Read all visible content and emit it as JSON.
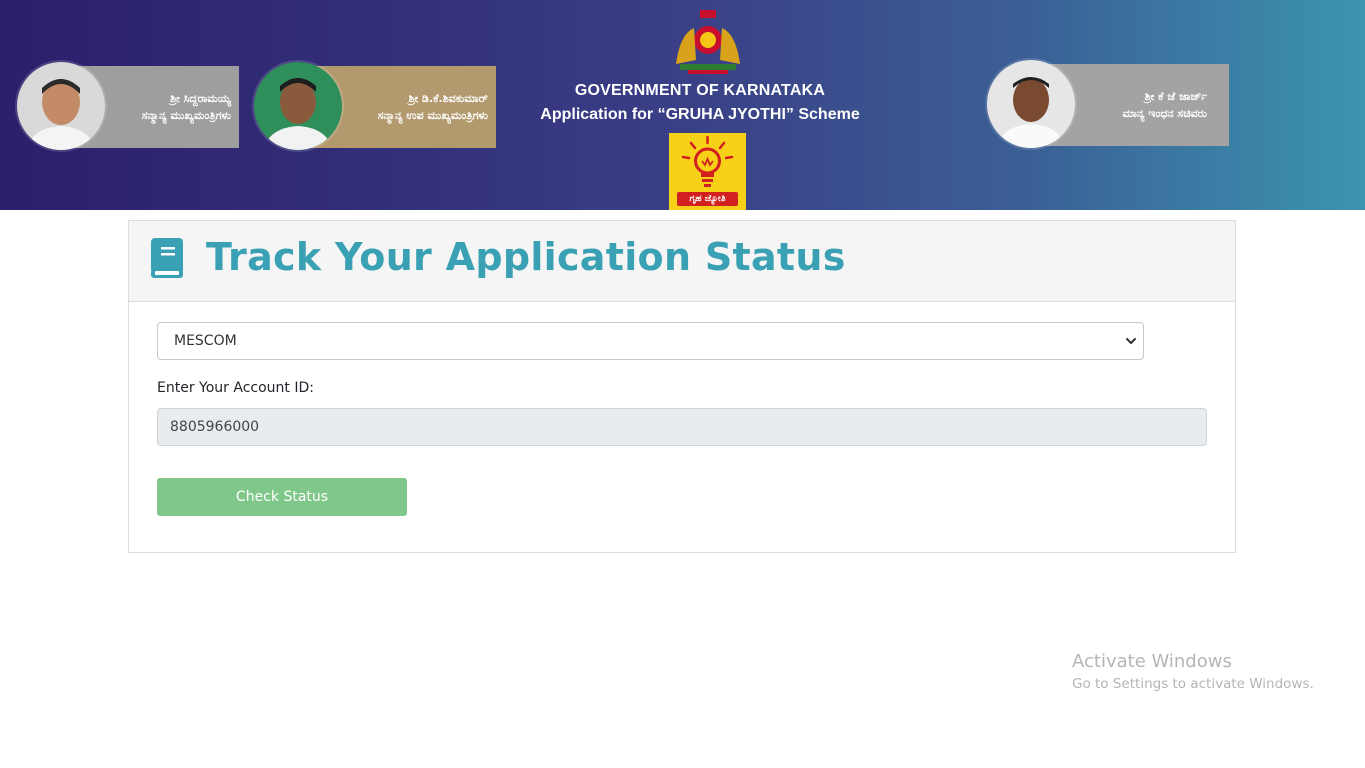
{
  "banner": {
    "leaders": [
      {
        "name_kn": "ಶ್ರೀ ಸಿದ್ದರಾಮಯ್ಯ",
        "title_kn": "ಸನ್ಮಾನ್ಯ ಮುಖ್ಯಮಂತ್ರಿಗಳು",
        "plate_color": "#9e9e9e"
      },
      {
        "name_kn": "ಶ್ರೀ ಡಿ.ಕೆ.ಶಿವಕುಮಾರ್",
        "title_kn": "ಸನ್ಮಾನ್ಯ ಉಪ ಮುಖ್ಯಮಂತ್ರಿಗಳು",
        "plate_color": "#b39a6e"
      },
      {
        "name_kn": "ಶ್ರೀ ಕೆ ಜೆ ಜಾರ್ಜ್",
        "title_kn": "ಮಾನ್ಯ ಇಂಧನ ಸಚಿವರು",
        "plate_color": "#a3a3a3"
      }
    ],
    "gov_title": "GOVERNMENT OF KARNATAKA",
    "app_title": "Application for “GRUHA JYOTHI” Scheme",
    "scheme_logo_text": "ಗೃಹ ಜ್ಯೋತಿ",
    "emblem_icon": "karnataka-emblem-icon",
    "scheme_icon": "light-bulb-icon"
  },
  "card": {
    "title": "Track Your Application Status",
    "title_icon": "book-icon",
    "title_color": "#3aa0b3",
    "escom_select": {
      "selected": "MESCOM",
      "options": [
        "MESCOM"
      ]
    },
    "account_label": "Enter Your Account ID:",
    "account_value": "8805966000",
    "button_label": "Check Status",
    "button_color": "#7fc88a"
  },
  "watermark": {
    "title": "Activate Windows",
    "subtitle": "Go to Settings to activate Windows."
  }
}
